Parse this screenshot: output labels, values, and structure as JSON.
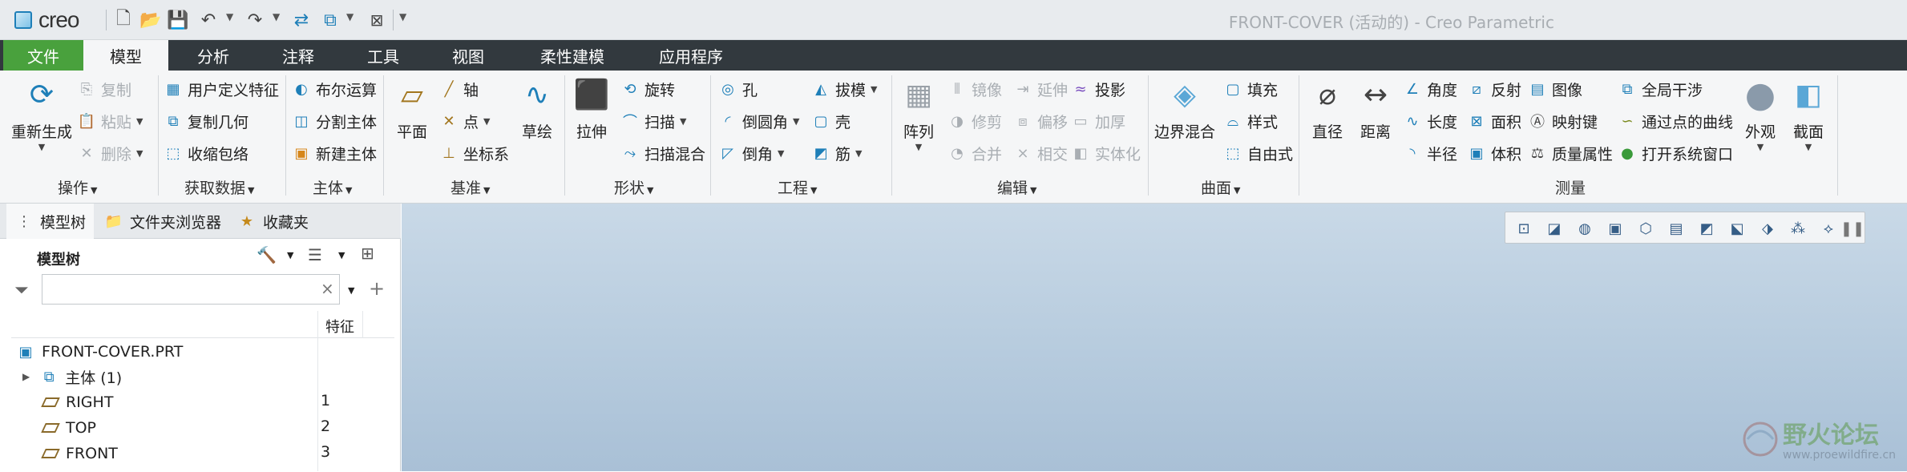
{
  "titlebar": {
    "logo_text": "creo",
    "window_title": "FRONT-COVER (活动的) - Creo Parametric"
  },
  "tabs": [
    "文件",
    "模型",
    "分析",
    "注释",
    "工具",
    "视图",
    "柔性建模",
    "应用程序"
  ],
  "ribbon": {
    "ops": {
      "regen": "重新生成",
      "copy": "复制",
      "paste": "粘贴",
      "delete": "删除",
      "label": "操作"
    },
    "getdata": {
      "udf": "用户定义特征",
      "copygeom": "复制几何",
      "shrinkwrap": "收缩包络",
      "label": "获取数据"
    },
    "body": {
      "boolean": "布尔运算",
      "split": "分割主体",
      "newbody": "新建主体",
      "label": "主体"
    },
    "datum": {
      "plane": "平面",
      "axis": "轴",
      "point": "点",
      "csys": "坐标系",
      "sketch": "草绘",
      "label": "基准"
    },
    "shapes": {
      "extrude": "拉伸",
      "revolve": "旋转",
      "sweep": "扫描",
      "sweptblend": "扫描混合",
      "label": "形状"
    },
    "eng": {
      "hole": "孔",
      "round": "倒圆角",
      "chamfer": "倒角",
      "draft": "拔模",
      "shell": "壳",
      "rib": "筋",
      "label": "工程"
    },
    "edit": {
      "pattern": "阵列",
      "mirror": "镜像",
      "trim": "修剪",
      "merge": "合并",
      "extend": "延伸",
      "offset": "偏移",
      "intersect": "相交",
      "project": "投影",
      "thicken": "加厚",
      "solidify": "实体化",
      "label": "编辑"
    },
    "surf": {
      "boundary": "边界混合",
      "fill": "填充",
      "style": "样式",
      "freestyle": "自由式",
      "label": "曲面"
    },
    "meas": {
      "diameter": "直径",
      "distance": "距离",
      "angle": "角度",
      "length": "长度",
      "radius": "半径",
      "reflect": "反射",
      "area": "面积",
      "volume": "体积",
      "image": "图像",
      "mapkey": "映射键",
      "massprop": "质量属性",
      "interference": "全局干涉",
      "curvepts": "通过点的曲线",
      "syswin": "打开系统窗口",
      "label": "测量"
    },
    "appearance": "外观",
    "section": "截面"
  },
  "leftpanel": {
    "tabs": [
      "模型树",
      "文件夹浏览器",
      "收藏夹"
    ],
    "title": "模型树",
    "search_placeholder": "",
    "col_header": "特征",
    "rows": [
      {
        "name": "FRONT-COVER.PRT",
        "num": ""
      },
      {
        "name": "主体 (1)",
        "num": ""
      },
      {
        "name": "RIGHT",
        "num": "1"
      },
      {
        "name": "TOP",
        "num": "2"
      },
      {
        "name": "FRONT",
        "num": "3"
      }
    ]
  },
  "watermark": {
    "brand": "野火论坛",
    "url": "www.proewildfire.cn"
  },
  "colors": {
    "file_tab": "#49a13d",
    "tabbar": "#32393e",
    "ribbon_bg": "#f5f6f7",
    "viewport_top": "#c9d9e7",
    "icon_blue": "#1e7fb8"
  }
}
